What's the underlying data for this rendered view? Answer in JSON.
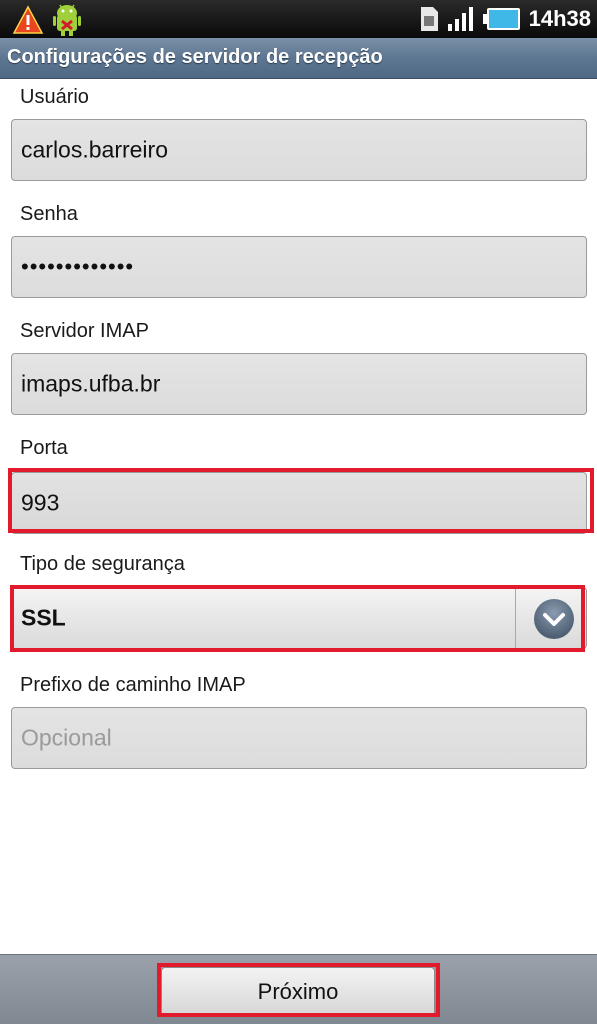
{
  "status_bar": {
    "time": "14h38",
    "icons": [
      "warning-icon",
      "android-debug-icon",
      "sim-icon",
      "signal-icon",
      "battery-icon"
    ]
  },
  "title": "Configurações de servidor de recepção",
  "form": {
    "username": {
      "label": "Usuário",
      "value": "carlos.barreiro"
    },
    "password": {
      "label": "Senha",
      "value": "•••••••••••••"
    },
    "imap_server": {
      "label": "Servidor IMAP",
      "value": "imaps.ufba.br"
    },
    "port": {
      "label": "Porta",
      "value": "993"
    },
    "security_type": {
      "label": "Tipo de segurança",
      "value": "SSL"
    },
    "imap_path_prefix": {
      "label": "Prefixo de caminho IMAP",
      "placeholder": "Opcional",
      "value": ""
    }
  },
  "buttons": {
    "next": "Próximo"
  },
  "colors": {
    "highlight": "#e11b2b",
    "title_bar": "#5d7691",
    "status_bar": "#111111"
  }
}
